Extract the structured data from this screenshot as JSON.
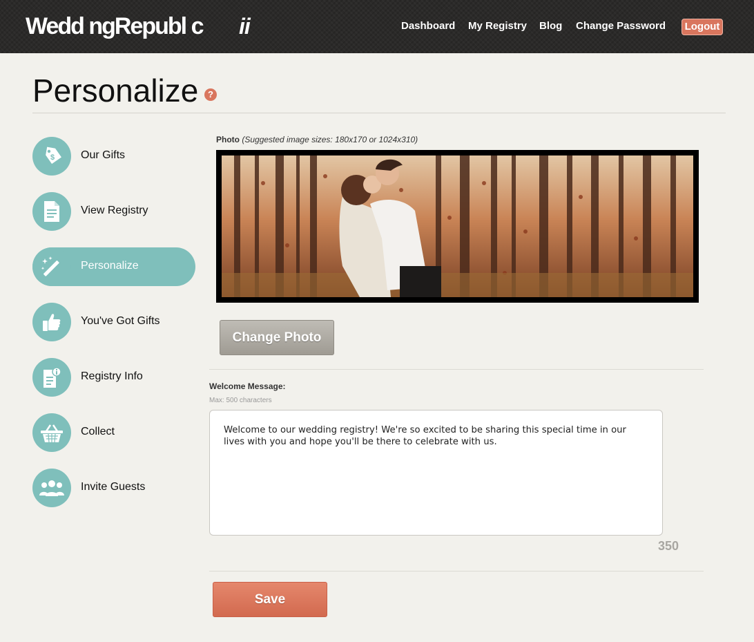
{
  "header": {
    "logo": "Wedd ngRepubl c",
    "logo_mark": "ii",
    "nav": [
      "Dashboard",
      "My Registry",
      "Blog",
      "Change Password"
    ],
    "logout": "Logout"
  },
  "page": {
    "title": "Personalize",
    "help": "?"
  },
  "sidebar": {
    "items": [
      {
        "label": "Our Gifts",
        "icon": "price-tag-icon",
        "active": false
      },
      {
        "label": "View Registry",
        "icon": "document-icon",
        "active": false
      },
      {
        "label": "Personalize",
        "icon": "magic-wand-icon",
        "active": true
      },
      {
        "label": "You've Got Gifts",
        "icon": "thumbs-up-icon",
        "active": false
      },
      {
        "label": "Registry Info",
        "icon": "info-document-icon",
        "active": false
      },
      {
        "label": "Collect",
        "icon": "basket-icon",
        "active": false
      },
      {
        "label": "Invite Guests",
        "icon": "group-icon",
        "active": false
      }
    ]
  },
  "main": {
    "photo_label": "Photo",
    "photo_hint": "(Suggested image sizes: 180x170 or 1024x310)",
    "change_photo": "Change Photo",
    "welcome_label": "Welcome Message:",
    "max_label": "Max: 500 characters",
    "welcome_text": "Welcome to our wedding registry! We're so excited to be sharing this special time in our lives with you and hope you'll be there to celebrate with us.",
    "chars_remaining": "350",
    "save": "Save"
  },
  "colors": {
    "accent_teal": "#7fbfbb",
    "accent_coral": "#d9765e",
    "header_bg": "#2b2a29"
  }
}
